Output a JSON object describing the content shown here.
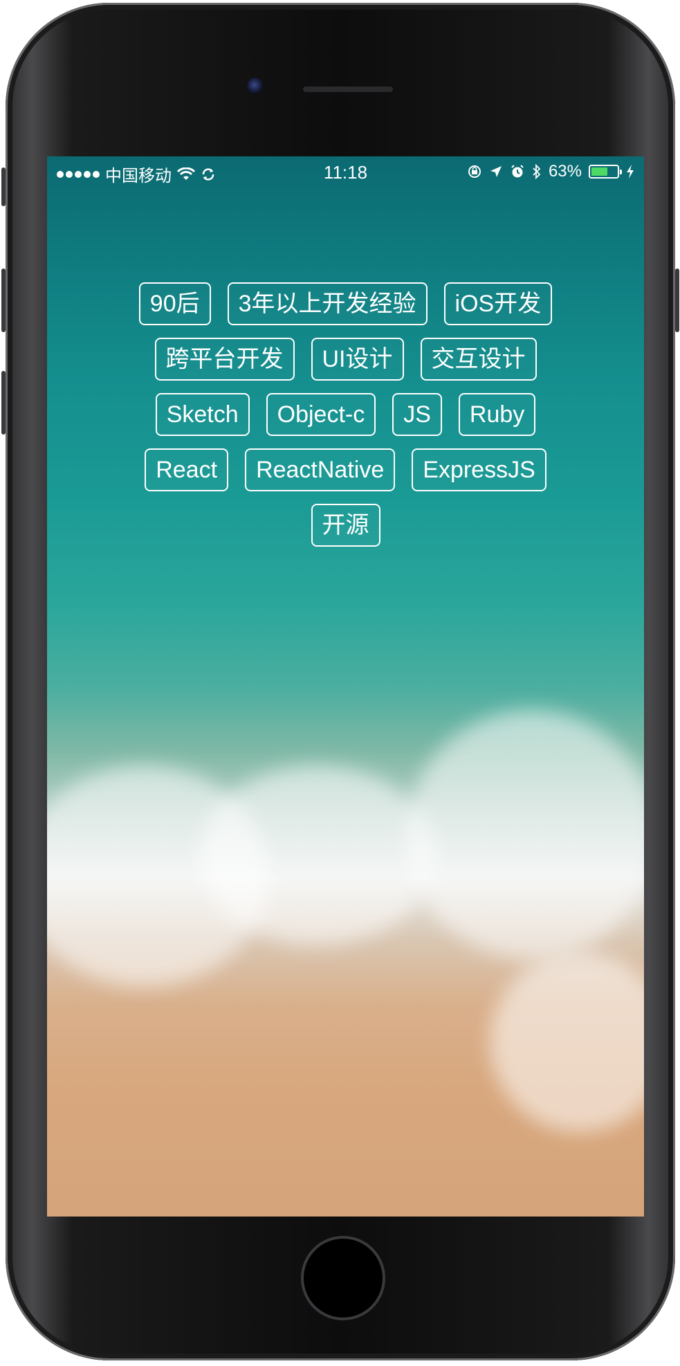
{
  "status_bar": {
    "carrier": "中国移动",
    "time": "11:18",
    "battery_percent_label": "63%",
    "battery_level": 0.63,
    "signal_icon": "signal-dots-icon",
    "wifi_icon": "wifi-icon",
    "sync_icon": "sync-icon",
    "lock_icon": "orientation-lock-icon",
    "location_icon": "location-arrow-icon",
    "alarm_icon": "alarm-icon",
    "bluetooth_icon": "bluetooth-icon",
    "charging_icon": "charging-bolt-icon"
  },
  "tags": [
    [
      "90后",
      "3年以上开发经验",
      "iOS开发"
    ],
    [
      "跨平台开发",
      "UI设计",
      "交互设计"
    ],
    [
      "Sketch",
      "Object-c",
      "JS",
      "Ruby"
    ],
    [
      "React",
      "ReactNative",
      "ExpressJS"
    ],
    [
      "开源"
    ]
  ],
  "colors": {
    "battery_fill": "#4cd964",
    "tag_border": "#ffffff",
    "tag_text": "#ffffff"
  }
}
